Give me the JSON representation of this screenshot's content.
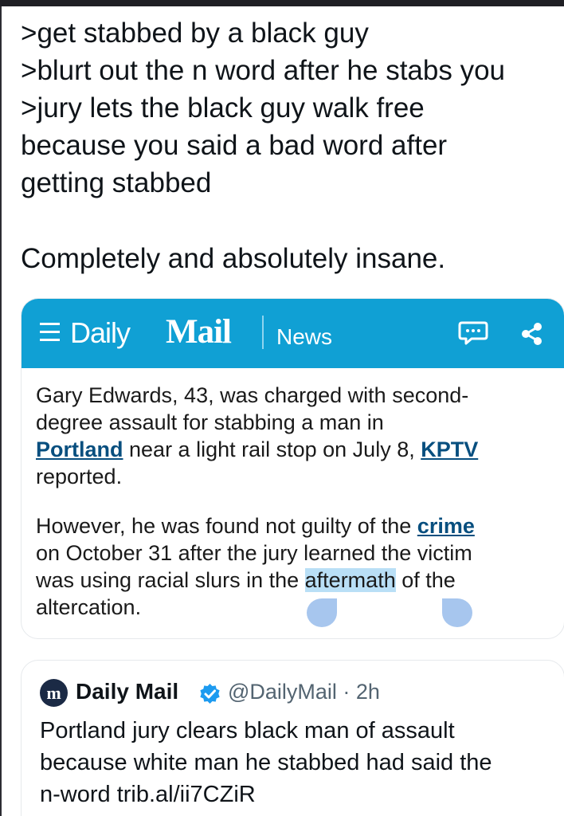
{
  "post": {
    "lines": [
      ">get stabbed by a black guy",
      ">blurt out the n word after he stabs you",
      ">jury lets the black guy walk free",
      "because you said a bad word after",
      "getting stabbed"
    ],
    "conclusion": "Completely and absolutely insane."
  },
  "article_card": {
    "brand": {
      "daily": "Daily",
      "mail": "Mail",
      "news": "News"
    },
    "icons": {
      "menu": "hamburger-menu-icon",
      "comment": "comment-icon",
      "share": "share-icon"
    },
    "colors": {
      "header": "#10a0d4",
      "link": "#084f7f",
      "selection": "#b9dff6"
    },
    "paragraph_1": {
      "line_1": "Gary Edwards, 43, was charged with second-",
      "line_2": "degree assault for stabbing a man in",
      "portland_link": "Portland",
      "line_3_after_link": " near a light rail stop on July 8, ",
      "kptv_link": "KPTV",
      "line_4": "reported."
    },
    "paragraph_2": {
      "line_1_before_link": "However, he was found not guilty of the ",
      "crime_link": "crime",
      "line_2": "on October 31 after the jury learned the victim",
      "line_3_before_highlight": "was using racial slurs in the ",
      "highlighted_word": "aftermath",
      "line_3_after_highlight": " of the",
      "line_4": "altercation."
    }
  },
  "tweet": {
    "avatar_letter": "m",
    "display_name": "Daily Mail",
    "handle_time": "@DailyMail · 2h",
    "verified_icon": "verified-badge-icon",
    "text_lines": [
      "Portland jury clears black man of assault",
      "because white man he stabbed had said the",
      "n-word trib.al/ii7CZiR"
    ]
  }
}
